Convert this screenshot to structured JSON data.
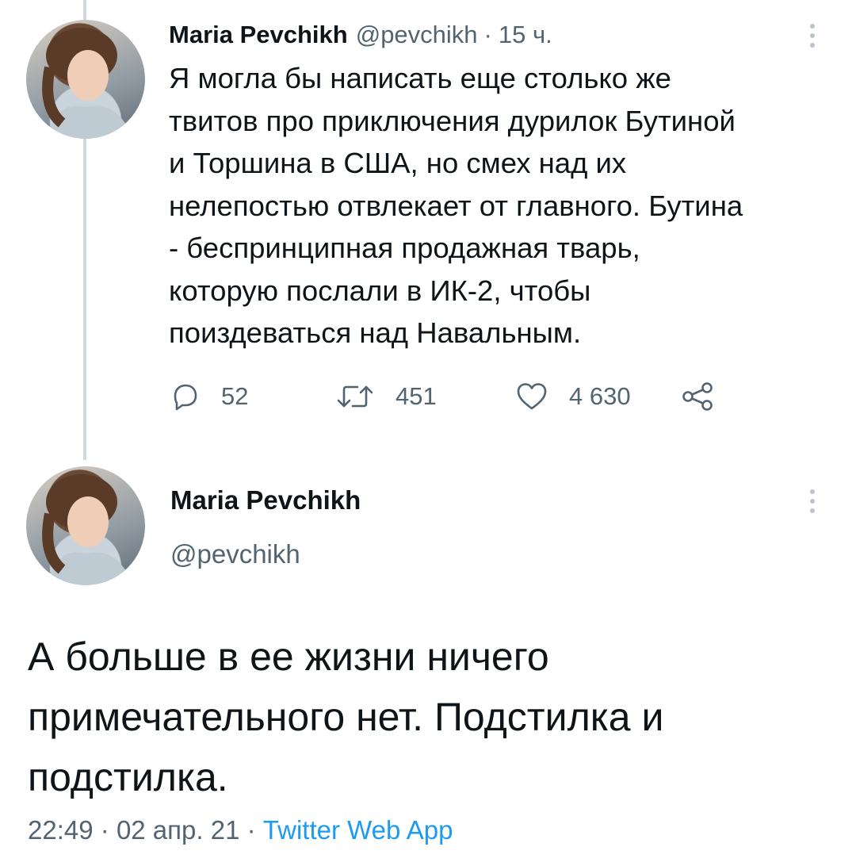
{
  "tweet1": {
    "author_name": "Maria Pevchikh",
    "handle": "@pevchikh",
    "separator": "·",
    "time": "15 ч.",
    "text": "Я могла бы написать еще столько же\nтвитов про приключения дурилок Бутиной\nи Торшина в США, но смех над их\nнелепостью отвлекает от главного. Бутина\n- беспринципная продажная тварь,\nкоторую послали в ИК-2, чтобы\nпоиздеваться над Навальным.",
    "replies": "52",
    "retweets": "451",
    "likes": "4 630",
    "icons": [
      "reply-icon",
      "retweet-icon",
      "like-icon",
      "share-icon",
      "more-icon"
    ]
  },
  "tweet2": {
    "author_name": "Maria Pevchikh",
    "handle": "@pevchikh",
    "text": "А больше в ее жизни ничего\nпримечательного нет. Подстилка и\nподстилка.",
    "time": "22:49",
    "separator": "·",
    "date": "02 апр. 21",
    "app": "Twitter Web App"
  },
  "colors": {
    "text": "#0f1419",
    "secondary": "#536471",
    "accent": "#1d9bf0",
    "thread_line": "#cfd9de"
  }
}
